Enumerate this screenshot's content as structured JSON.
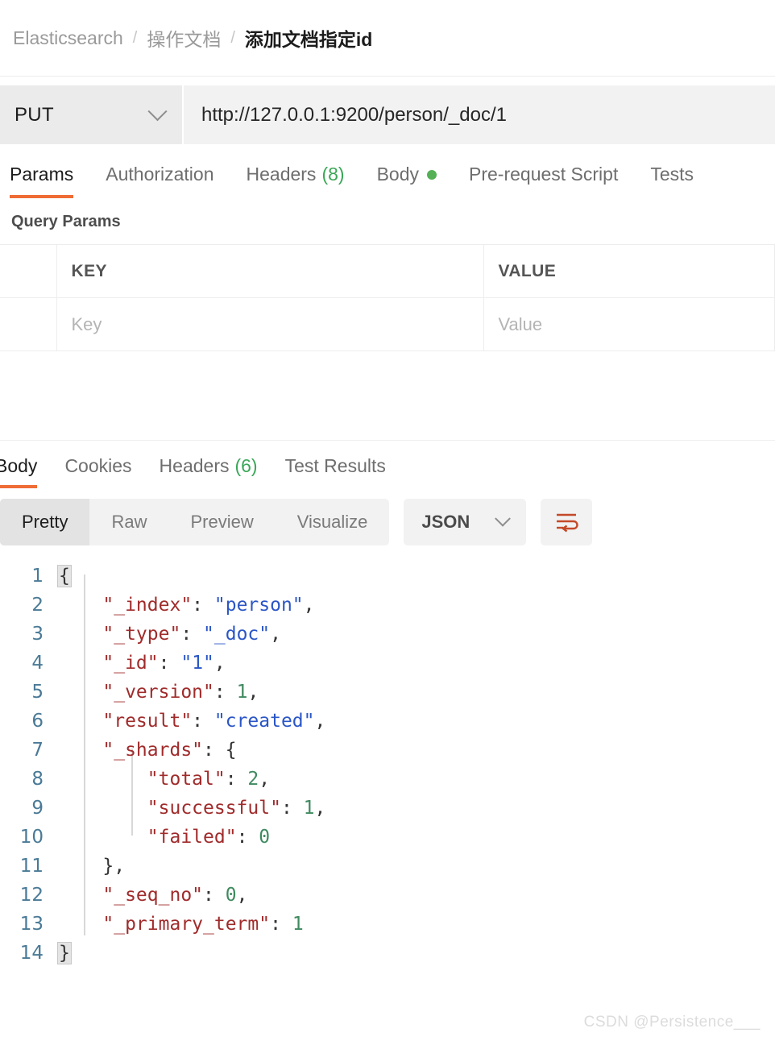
{
  "breadcrumb": {
    "items": [
      {
        "label": "Elasticsearch",
        "current": false
      },
      {
        "label": "操作文档",
        "current": false
      },
      {
        "label": "添加文档指定id",
        "current": true
      }
    ],
    "separator": "/"
  },
  "request": {
    "method": "PUT",
    "url": "http://127.0.0.1:9200/person/_doc/1",
    "tabs": [
      {
        "label": "Params",
        "active": true
      },
      {
        "label": "Authorization",
        "active": false
      },
      {
        "label": "Headers",
        "count": "(8)",
        "active": false
      },
      {
        "label": "Body",
        "dot": true,
        "active": false
      },
      {
        "label": "Pre-request Script",
        "active": false
      },
      {
        "label": "Tests",
        "active": false
      }
    ],
    "params": {
      "title": "Query Params",
      "columns": [
        "KEY",
        "VALUE"
      ],
      "rows": [
        {
          "key_placeholder": "Key",
          "value_placeholder": "Value"
        }
      ]
    }
  },
  "response": {
    "tabs": [
      {
        "label": "Body",
        "active": true
      },
      {
        "label": "Cookies",
        "active": false
      },
      {
        "label": "Headers",
        "count": "(6)",
        "active": false
      },
      {
        "label": "Test Results",
        "active": false
      }
    ],
    "format_buttons": [
      {
        "label": "Pretty",
        "active": true
      },
      {
        "label": "Raw",
        "active": false
      },
      {
        "label": "Preview",
        "active": false
      },
      {
        "label": "Visualize",
        "active": false
      }
    ],
    "language": "JSON",
    "wrap_icon": "word-wrap-icon",
    "body_lines": [
      {
        "no": "1",
        "text": "{"
      },
      {
        "no": "2",
        "text": "    \"_index\": \"person\","
      },
      {
        "no": "3",
        "text": "    \"_type\": \"_doc\","
      },
      {
        "no": "4",
        "text": "    \"_id\": \"1\","
      },
      {
        "no": "5",
        "text": "    \"_version\": 1,"
      },
      {
        "no": "6",
        "text": "    \"result\": \"created\","
      },
      {
        "no": "7",
        "text": "    \"_shards\": {"
      },
      {
        "no": "8",
        "text": "        \"total\": 2,"
      },
      {
        "no": "9",
        "text": "        \"successful\": 1,"
      },
      {
        "no": "10",
        "text": "        \"failed\": 0"
      },
      {
        "no": "11",
        "text": "    },"
      },
      {
        "no": "12",
        "text": "    \"_seq_no\": 0,"
      },
      {
        "no": "13",
        "text": "    \"_primary_term\": 1"
      },
      {
        "no": "14",
        "text": "}"
      }
    ]
  },
  "watermark": "CSDN @Persistence___",
  "colors": {
    "accent_orange": "#ef6c35",
    "count_green": "#3aa757",
    "dot_green": "#54b054",
    "json_key": "#a02b2b",
    "json_string": "#2a56c6",
    "json_number": "#3f8a5f",
    "line_number": "#4a7a96"
  }
}
